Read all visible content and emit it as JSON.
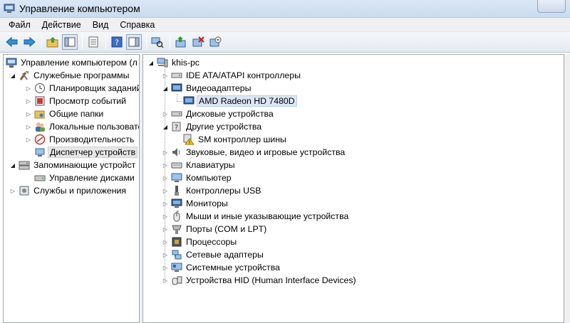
{
  "window": {
    "title": "Управление компьютером"
  },
  "menu": [
    "Файл",
    "Действие",
    "Вид",
    "Справка"
  ],
  "toolbar": {
    "icons": [
      "back-arrow-icon",
      "forward-arrow-icon",
      "up-folder-icon",
      "console-tree-icon",
      "properties-icon",
      "help-icon",
      "show-hide-icon",
      "scan-hardware-icon",
      "update-driver-icon",
      "uninstall-icon",
      "disable-icon"
    ]
  },
  "left_tree": {
    "root": "Управление компьютером (л",
    "system_tools": "Служебные программы",
    "system_tools_children": [
      "Планировщик заданий",
      "Просмотр событий",
      "Общие папки",
      "Локальные пользовате",
      "Производительность",
      "Диспетчер устройств"
    ],
    "storage": "Запоминающие устройст",
    "disk_management": "Управление дисками",
    "services": "Службы и приложения"
  },
  "device_tree": {
    "computer": "khis-pc",
    "categories": [
      {
        "label": "IDE ATA/ATAPI контроллеры",
        "icon": "ide-controller-icon"
      },
      {
        "label": "Видеоадаптеры",
        "icon": "display-adapter-icon"
      },
      {
        "label": "Дисковые устройства",
        "icon": "disk-drive-icon"
      },
      {
        "label": "Другие устройства",
        "icon": "other-devices-icon"
      },
      {
        "label": "Звуковые, видео и игровые устройства",
        "icon": "speaker-icon"
      },
      {
        "label": "Клавиатуры",
        "icon": "keyboard-icon"
      },
      {
        "label": "Компьютер",
        "icon": "computer-icon"
      },
      {
        "label": "Контроллеры USB",
        "icon": "usb-icon"
      },
      {
        "label": "Мониторы",
        "icon": "monitor-icon"
      },
      {
        "label": "Мыши и иные указывающие устройства",
        "icon": "mouse-icon"
      },
      {
        "label": "Порты (COM и LPT)",
        "icon": "port-icon"
      },
      {
        "label": "Процессоры",
        "icon": "processor-icon"
      },
      {
        "label": "Сетевые адаптеры",
        "icon": "network-adapter-icon"
      },
      {
        "label": "Системные устройства",
        "icon": "system-devices-icon"
      },
      {
        "label": "Устройства HID (Human Interface Devices)",
        "icon": "hid-icon"
      }
    ],
    "video_child": "AMD Radeon HD 7480D",
    "other_child": "SM контроллер шины"
  }
}
